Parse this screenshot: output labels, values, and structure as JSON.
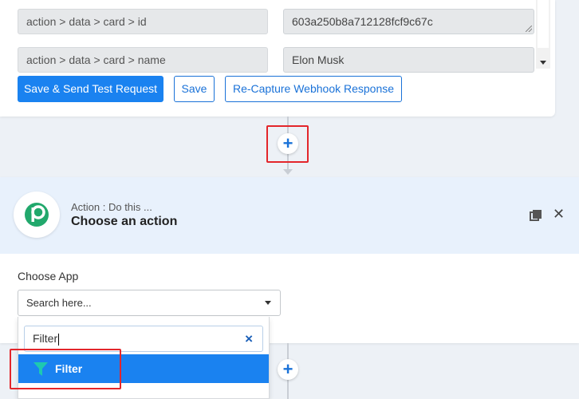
{
  "mappings": [
    {
      "key": "action > data > card > id",
      "value": "603a250b8a712128fcf9c67c"
    },
    {
      "key": "action > data > card > name",
      "value": "Elon Musk"
    }
  ],
  "buttons": {
    "save_send": "Save & Send Test Request",
    "save": "Save",
    "recapture": "Re-Capture Webhook Response"
  },
  "connector": {
    "plus": "+"
  },
  "action": {
    "subtitle": "Action : Do this ...",
    "title": "Choose an action",
    "choose_app_label": "Choose App",
    "select_placeholder": "Search here..."
  },
  "dropdown": {
    "search_value": "Filter",
    "clear": "×",
    "options": [
      {
        "label": "Filter",
        "icon": "funnel-icon"
      }
    ]
  },
  "colors": {
    "accent": "#1a82f0",
    "highlight": "#e3262b",
    "header_bg": "#e8f1fc"
  }
}
